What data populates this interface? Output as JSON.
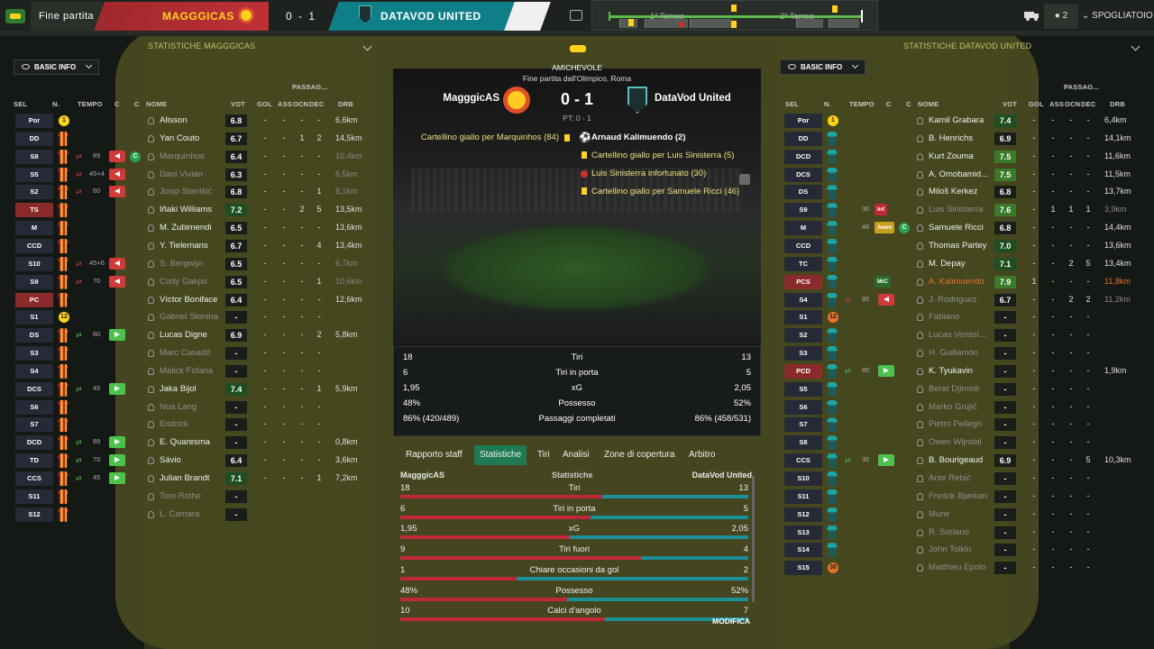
{
  "topbar": {
    "fine_partita": "Fine partita",
    "home_name": "MAGGGICAS",
    "score": "0 - 1",
    "away_name": "DATAVOD UNITED",
    "timeline_first": "1° Tempo",
    "timeline_second": "2° Tempo",
    "player_count": "2",
    "spogliatoio": "SPOGLIATOIO"
  },
  "left": {
    "title": "STATISTICHE MAGGGICAS",
    "view": "BASIC INFO",
    "headers": {
      "sel": "SEL",
      "n": "N.",
      "tempo": "TEMPO",
      "c1": "C",
      "c2": "C",
      "nome": "NOME",
      "vot": "VOT",
      "gol": "GOL",
      "ass": "ASS",
      "passaggi": "PASSAG...",
      "ocn": "OCN",
      "dec": "DEC",
      "drb": "DRB"
    },
    "rows": [
      {
        "pos": "Por",
        "name": "Alisson",
        "vot": "6.8",
        "gol": "-",
        "ass": "-",
        "ocn": "-",
        "dec": "-",
        "drb": "6,6km",
        "gk": "1",
        "dim": false
      },
      {
        "pos": "DD",
        "name": "Yan Couto",
        "vot": "6.7",
        "gol": "-",
        "ass": "-",
        "ocn": "1",
        "dec": "2",
        "drb": "14,5km",
        "dim": false
      },
      {
        "pos": "S8",
        "name": "Marquinhos",
        "vot": "6.4",
        "gol": "-",
        "ass": "-",
        "ocn": "-",
        "dec": "-",
        "drb": "10,4km",
        "min": "89",
        "sub": "out",
        "circ": "C",
        "dim": true
      },
      {
        "pos": "S5",
        "name": "Dani Vivian",
        "vot": "6.3",
        "gol": "-",
        "ass": "-",
        "ocn": "-",
        "dec": "-",
        "drb": "6,5km",
        "min": "45+4",
        "sub": "out",
        "dim": true
      },
      {
        "pos": "S2",
        "name": "Josip Stanišić",
        "vot": "6.8",
        "gol": "-",
        "ass": "-",
        "ocn": "-",
        "dec": "1",
        "drb": "8,1km",
        "min": "60",
        "sub": "out",
        "dim": true
      },
      {
        "pos": "TS",
        "name": "Iñaki Williams",
        "vot": "7.2",
        "gol": "-",
        "ass": "-",
        "ocn": "2",
        "dec": "5",
        "drb": "13,5km",
        "dim": false,
        "red": true
      },
      {
        "pos": "M",
        "name": "M. Zubimendi",
        "vot": "6.5",
        "gol": "-",
        "ass": "-",
        "ocn": "-",
        "dec": "-",
        "drb": "13,6km",
        "dim": false
      },
      {
        "pos": "CCD",
        "name": "Y. Tielemans",
        "vot": "6.7",
        "gol": "-",
        "ass": "-",
        "ocn": "-",
        "dec": "4",
        "drb": "13,4km",
        "dim": false
      },
      {
        "pos": "S10",
        "name": "S. Bergwijn",
        "vot": "6.5",
        "gol": "-",
        "ass": "-",
        "ocn": "-",
        "dec": "-",
        "drb": "6,7km",
        "min": "45+6",
        "sub": "out",
        "dim": true
      },
      {
        "pos": "S9",
        "name": "Cody Gakpo",
        "vot": "6.5",
        "gol": "-",
        "ass": "-",
        "ocn": "-",
        "dec": "1",
        "drb": "10,6km",
        "min": "70",
        "sub": "out",
        "dim": true
      },
      {
        "pos": "PC",
        "name": "Víctor Boniface",
        "vot": "6.4",
        "gol": "-",
        "ass": "-",
        "ocn": "-",
        "dec": "-",
        "drb": "12,6km",
        "dim": false,
        "red": true
      },
      {
        "pos": "S1",
        "name": "Gabriel Słonina",
        "vot": "-",
        "gol": "-",
        "ass": "-",
        "ocn": "-",
        "dec": "-",
        "drb": "",
        "gk": "12",
        "dim": true
      },
      {
        "pos": "DS",
        "name": "Lucas Digne",
        "vot": "6.9",
        "gol": "-",
        "ass": "-",
        "ocn": "-",
        "dec": "2",
        "drb": "5,8km",
        "min": "60",
        "sub": "in",
        "dim": false
      },
      {
        "pos": "S3",
        "name": "Marc Casadó",
        "vot": "-",
        "gol": "-",
        "ass": "-",
        "ocn": "-",
        "dec": "-",
        "drb": "",
        "dim": true
      },
      {
        "pos": "S4",
        "name": "Malick Fofana",
        "vot": "-",
        "gol": "-",
        "ass": "-",
        "ocn": "-",
        "dec": "-",
        "drb": "",
        "dim": true
      },
      {
        "pos": "DCS",
        "name": "Jaka Bijol",
        "vot": "7.4",
        "gol": "-",
        "ass": "-",
        "ocn": "-",
        "dec": "1",
        "drb": "5,9km",
        "min": "45",
        "sub": "in",
        "dim": false
      },
      {
        "pos": "S6",
        "name": "Noa Lang",
        "vot": "-",
        "gol": "-",
        "ass": "-",
        "ocn": "-",
        "dec": "-",
        "drb": "",
        "dim": true
      },
      {
        "pos": "S7",
        "name": "Endrick",
        "vot": "-",
        "gol": "-",
        "ass": "-",
        "ocn": "-",
        "dec": "-",
        "drb": "",
        "dim": true
      },
      {
        "pos": "DCD",
        "name": "E. Quaresma",
        "vot": "-",
        "gol": "-",
        "ass": "-",
        "ocn": "-",
        "dec": "-",
        "drb": "0,8km",
        "min": "89",
        "sub": "in",
        "dim": false
      },
      {
        "pos": "TD",
        "name": "Sávio",
        "vot": "6.4",
        "gol": "-",
        "ass": "-",
        "ocn": "-",
        "dec": "-",
        "drb": "3,6km",
        "min": "70",
        "sub": "in",
        "dim": false
      },
      {
        "pos": "CCS",
        "name": "Julian Brandt",
        "vot": "7.1",
        "gol": "-",
        "ass": "-",
        "ocn": "-",
        "dec": "1",
        "drb": "7,2km",
        "min": "45",
        "sub": "in",
        "dim": false
      },
      {
        "pos": "S11",
        "name": "Tom Rothe",
        "vot": "-",
        "gol": "",
        "ass": "",
        "ocn": "",
        "dec": "",
        "drb": "",
        "dim": true
      },
      {
        "pos": "S12",
        "name": "L. Camara",
        "vot": "-",
        "gol": "",
        "ass": "",
        "ocn": "",
        "dec": "",
        "drb": "",
        "dim": true
      }
    ]
  },
  "right": {
    "title": "STATISTICHE DATAVOD UNITED",
    "view": "BASIC INFO",
    "headers": {
      "sel": "SEL",
      "n": "N.",
      "tempo": "TEMPO",
      "c1": "C",
      "c2": "C",
      "nome": "NOME",
      "vot": "VOT",
      "gol": "GOL",
      "ass": "ASS",
      "passaggi": "PASSAG...",
      "ocn": "OCN",
      "dec": "DEC",
      "drb": "DRB"
    },
    "rows": [
      {
        "pos": "Por",
        "name": "Kamil Grabara",
        "vot": "7.4",
        "gol": "-",
        "ass": "-",
        "ocn": "-",
        "dec": "-",
        "drb": "6,4km",
        "gk": "1",
        "dim": false
      },
      {
        "pos": "DD",
        "name": "B. Henrichs",
        "vot": "6.9",
        "gol": "-",
        "ass": "-",
        "ocn": "-",
        "dec": "-",
        "drb": "14,1km",
        "dim": false
      },
      {
        "pos": "DCD",
        "name": "Kurt Zouma",
        "vot": "7.5",
        "gol": "-",
        "ass": "-",
        "ocn": "-",
        "dec": "-",
        "drb": "11,6km",
        "dim": false
      },
      {
        "pos": "DCS",
        "name": "A. Omobamid...",
        "vot": "7.5",
        "gol": "-",
        "ass": "-",
        "ocn": "-",
        "dec": "-",
        "drb": "11,5km",
        "dim": false
      },
      {
        "pos": "DS",
        "name": "Miloš Kerkez",
        "vot": "6.8",
        "gol": "-",
        "ass": "-",
        "ocn": "-",
        "dec": "-",
        "drb": "13,7km",
        "dim": false
      },
      {
        "pos": "S9",
        "name": "Luis Sinisterra",
        "vot": "7.6",
        "gol": "-",
        "ass": "1",
        "ocn": "1",
        "dec": "1",
        "drb": "3,9km",
        "min": "30",
        "tag": "Inf",
        "dim": true
      },
      {
        "pos": "M",
        "name": "Samuele Ricci",
        "vot": "6.8",
        "gol": "-",
        "ass": "-",
        "ocn": "-",
        "dec": "-",
        "drb": "14,4km",
        "min": "46",
        "tag": "Amm",
        "circ": "C",
        "dim": false
      },
      {
        "pos": "CCD",
        "name": "Thomas Partey",
        "vot": "7.0",
        "gol": "-",
        "ass": "-",
        "ocn": "-",
        "dec": "-",
        "drb": "13,6km",
        "dim": false
      },
      {
        "pos": "TC",
        "name": "M. Depay",
        "vot": "7.1",
        "gol": "-",
        "ass": "-",
        "ocn": "2",
        "dec": "5",
        "drb": "13,4km",
        "dim": false
      },
      {
        "pos": "PCS",
        "name": "A. Kalimuendo",
        "vot": "7.9",
        "gol": "1",
        "ass": "-",
        "ocn": "-",
        "dec": "-",
        "drb": "11,8km",
        "tag": "MiC",
        "dim": false,
        "hi": true,
        "red": true
      },
      {
        "pos": "S4",
        "name": "J. Rodriguez",
        "vot": "6.7",
        "gol": "-",
        "ass": "-",
        "ocn": "2",
        "dec": "2",
        "drb": "11,2km",
        "min": "80",
        "sub": "out",
        "dim": true
      },
      {
        "pos": "S1",
        "name": "Fabiano",
        "vot": "-",
        "gol": "-",
        "ass": "-",
        "ocn": "-",
        "dec": "-",
        "drb": "",
        "gk": "12",
        "dim": true
      },
      {
        "pos": "S2",
        "name": "Lucas Verissi...",
        "vot": "-",
        "gol": "-",
        "ass": "-",
        "ocn": "-",
        "dec": "-",
        "drb": "",
        "dim": true
      },
      {
        "pos": "S3",
        "name": "H. Guillamón",
        "vot": "-",
        "gol": "-",
        "ass": "-",
        "ocn": "-",
        "dec": "-",
        "drb": "",
        "dim": true
      },
      {
        "pos": "PCD",
        "name": "K. Tyukavin",
        "vot": "-",
        "gol": "-",
        "ass": "-",
        "ocn": "-",
        "dec": "-",
        "drb": "1,9km",
        "min": "80",
        "sub": "in",
        "dim": false,
        "red": true
      },
      {
        "pos": "S5",
        "name": "Berat Djimsiti",
        "vot": "-",
        "gol": "-",
        "ass": "-",
        "ocn": "-",
        "dec": "-",
        "drb": "",
        "dim": true
      },
      {
        "pos": "S6",
        "name": "Marko Grujić",
        "vot": "-",
        "gol": "-",
        "ass": "-",
        "ocn": "-",
        "dec": "-",
        "drb": "",
        "dim": true
      },
      {
        "pos": "S7",
        "name": "Pietro Pellegri",
        "vot": "-",
        "gol": "-",
        "ass": "-",
        "ocn": "-",
        "dec": "-",
        "drb": "",
        "dim": true
      },
      {
        "pos": "S8",
        "name": "Owen Wijndal",
        "vot": "-",
        "gol": "-",
        "ass": "-",
        "ocn": "-",
        "dec": "-",
        "drb": "",
        "dim": true
      },
      {
        "pos": "CCS",
        "name": "B. Bourigeaud",
        "vot": "6.9",
        "gol": "-",
        "ass": "-",
        "ocn": "-",
        "dec": "5",
        "drb": "10,3km",
        "min": "30",
        "sub": "in",
        "dim": false
      },
      {
        "pos": "S10",
        "name": "Ante Rebić",
        "vot": "-",
        "gol": "-",
        "ass": "-",
        "ocn": "-",
        "dec": "-",
        "drb": "",
        "dim": true
      },
      {
        "pos": "S11",
        "name": "Fredrik Bjørkan",
        "vot": "-",
        "gol": "-",
        "ass": "-",
        "ocn": "-",
        "dec": "-",
        "drb": "",
        "dim": true
      },
      {
        "pos": "S12",
        "name": "Munir",
        "vot": "-",
        "gol": "-",
        "ass": "-",
        "ocn": "-",
        "dec": "-",
        "drb": "",
        "dim": true
      },
      {
        "pos": "S13",
        "name": "R. Soriano",
        "vot": "-",
        "gol": "-",
        "ass": "-",
        "ocn": "-",
        "dec": "-",
        "drb": "",
        "dim": true
      },
      {
        "pos": "S14",
        "name": "John Tolkin",
        "vot": "-",
        "gol": "-",
        "ass": "-",
        "ocn": "-",
        "dec": "-",
        "drb": "",
        "dim": true
      },
      {
        "pos": "S15",
        "name": "Matthieu Epolo",
        "vot": "-",
        "gol": "-",
        "ass": "-",
        "ocn": "-",
        "dec": "-",
        "drb": "",
        "gk": "30",
        "dim": true
      }
    ]
  },
  "center": {
    "competition": "AMICHEVOLE",
    "venue": "Fine partita dall'Olimpico, Roma",
    "home_team": "MagggicAS",
    "away_team": "DataVod United",
    "score": "0 - 1",
    "halftime": "PT: 0 - 1",
    "home_events": [
      "Cartellino giallo per Marquinhos (84)"
    ],
    "away_events": [
      "Arnaud Kalimuendo (2)",
      "Cartellino giallo per Luis Sinisterra (5)",
      "Luis Sinisterra infortunato (30)",
      "Cartellino giallo per Samuele Ricci (46)"
    ],
    "summary": [
      {
        "h": "18",
        "label": "Tiri",
        "a": "13"
      },
      {
        "h": "6",
        "label": "Tiri in porta",
        "a": "5"
      },
      {
        "h": "1,95",
        "label": "xG",
        "a": "2,05"
      },
      {
        "h": "48%",
        "label": "Possesso",
        "a": "52%"
      },
      {
        "h": "86% (420/489)",
        "label": "Passaggi completati",
        "a": "86% (458/531)"
      }
    ],
    "tabs": [
      "Rapporto staff",
      "Statistiche",
      "Tiri",
      "Analisi",
      "Zone di copertura",
      "Arbitro"
    ],
    "stats_header": {
      "home": "MagggicAS",
      "mid": "Statistiche",
      "away": "DataVod United"
    },
    "compare": [
      {
        "h": "18",
        "label": "Tiri",
        "a": "13",
        "hv": 18,
        "av": 13
      },
      {
        "h": "6",
        "label": "Tiri in porta",
        "a": "5",
        "hv": 6,
        "av": 5
      },
      {
        "h": "1,95",
        "label": "xG",
        "a": "2,05",
        "hv": 1.95,
        "av": 2.05
      },
      {
        "h": "9",
        "label": "Tiri fuori",
        "a": "4",
        "hv": 9,
        "av": 4
      },
      {
        "h": "1",
        "label": "Chiare occasioni da gol",
        "a": "2",
        "hv": 1,
        "av": 2
      },
      {
        "h": "48%",
        "label": "Possesso",
        "a": "52%",
        "hv": 48,
        "av": 52
      },
      {
        "h": "10",
        "label": "Calci d'angolo",
        "a": "7",
        "hv": 10,
        "av": 7
      }
    ],
    "modifica": "MODIFICA"
  }
}
